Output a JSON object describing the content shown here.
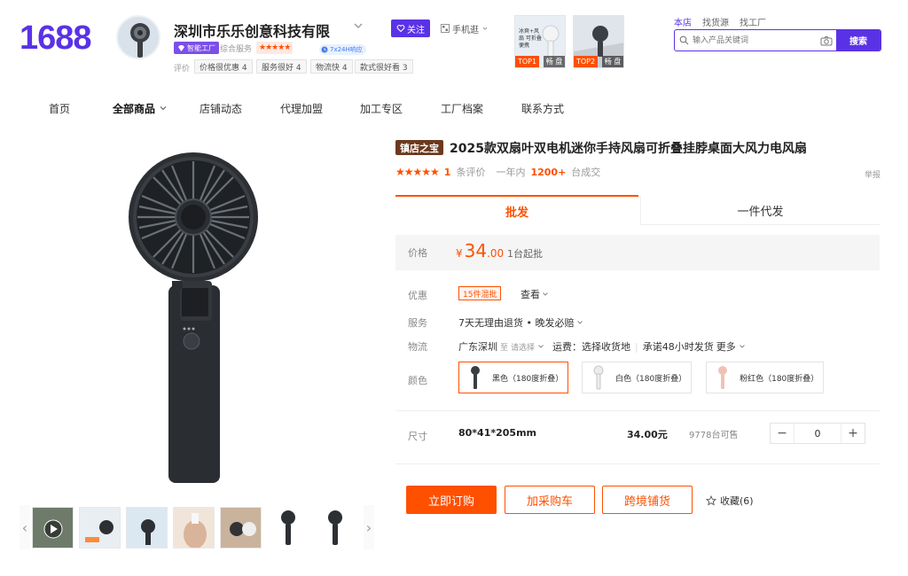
{
  "brand": {
    "logo_text": "1688",
    "accent": "#5a32e6"
  },
  "shop": {
    "name": "深圳市乐乐创意科技有限",
    "follow_label": "关注",
    "mobile_label": "手机逛",
    "factory_badge": "智能工厂",
    "service_label": "综合服务",
    "service_stars": "★★★★★",
    "badge_24h": "7x24H响应",
    "eval_label": "评价",
    "eval_tags": [
      "价格很优惠 4",
      "服务很好 4",
      "物流快 4",
      "款式很好看 3"
    ]
  },
  "top_products": [
    {
      "rank": "TOP1",
      "tag": "畅 盘",
      "caption": "冰爽+风扇 可折叠便携"
    },
    {
      "rank": "TOP2",
      "tag": "畅 盘"
    }
  ],
  "search": {
    "tabs": [
      "本店",
      "找货源",
      "找工厂"
    ],
    "placeholder": "输入产品关键词",
    "button": "搜索"
  },
  "nav": {
    "items": [
      "首页",
      "全部商品",
      "店铺动态",
      "代理加盟",
      "加工专区",
      "工厂档案",
      "联系方式"
    ]
  },
  "product": {
    "badge": "镇店之宝",
    "title": "2025款双扇叶双电机迷你手持风扇可折叠挂脖桌面大风力电风扇",
    "stars": "★★★★★",
    "review_count": "1",
    "review_label": "条评价",
    "sales_prefix": "一年内",
    "sales_count": "1200+",
    "sales_suffix": "台成交",
    "report": "举报",
    "tabs": {
      "wholesale": "批发",
      "dropship": "一件代发"
    },
    "price": {
      "label": "价格",
      "currency": "¥",
      "integer": "34",
      "decimal": ".00",
      "moq": "1台起批"
    },
    "promo": {
      "label": "优惠",
      "tag": "15件混批",
      "view": "查看"
    },
    "service": {
      "label": "服务",
      "text": "7天无理由退货 • 晚发必赔"
    },
    "logistics": {
      "label": "物流",
      "from": "广东深圳",
      "to_prefix": "至",
      "to_placeholder": "请选择",
      "fee": "运费：选择收货地",
      "promise": "承诺48小时发货",
      "more": "更多"
    },
    "color": {
      "label": "颜色",
      "options": [
        {
          "name": "黑色（180度折叠）",
          "swatch": "#3a3d42",
          "selected": true
        },
        {
          "name": "白色（180度折叠）",
          "swatch": "#e9e9ea",
          "selected": false
        },
        {
          "name": "粉红色（180度折叠）",
          "swatch": "#f0c2b6",
          "selected": false
        }
      ]
    },
    "size": {
      "label": "尺寸",
      "value": "80*41*205mm",
      "price": "34.00元",
      "stock": "9778台可售",
      "quantity": "0"
    },
    "actions": {
      "buy": "立即订购",
      "cart": "加采购车",
      "cross_border": "跨境铺货",
      "favorite": "收藏(6)"
    }
  },
  "colors": {
    "price": "#ff5000",
    "accent": "#5a32e6",
    "brand_brown": "#6b3a1e"
  }
}
